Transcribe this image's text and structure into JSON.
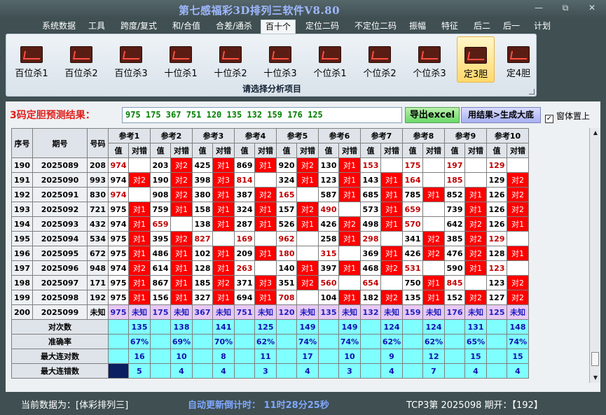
{
  "window": {
    "title": "第七感福彩3D排列三软件V8.80",
    "min": "—",
    "max": "⧉",
    "close": "✕"
  },
  "menu": [
    "系统数据",
    "工具",
    "跨度/复式",
    "和/合值",
    "合差/通杀",
    "百十个",
    "定位二码",
    "不定位二码",
    "振幅",
    "特征",
    "后二",
    "后一",
    "计划"
  ],
  "menu_active_index": 5,
  "ribbon": {
    "buttons": [
      "百位杀1",
      "百位杀2",
      "百位杀3",
      "十位杀1",
      "十位杀2",
      "十位杀3",
      "个位杀1",
      "个位杀2",
      "个位杀3",
      "定3胆",
      "定4胆"
    ],
    "selected_index": 9,
    "caption": "请选择分析项目"
  },
  "prediction": {
    "label": "3码定胆预测结果：",
    "value": "975 175 367 751 120 135 132 159 176 125",
    "export_button": "导出excel",
    "generate_button": "用结果>生成大底",
    "topmost_checkbox": "窗体置上",
    "topmost_checked": true
  },
  "table": {
    "col_seq": "序号",
    "col_issue": "期号",
    "col_code": "号码",
    "ref_headers": [
      "参考1",
      "参考2",
      "参考3",
      "参考4",
      "参考5",
      "参考6",
      "参考7",
      "参考8",
      "参考9",
      "参考10"
    ],
    "sub_value": "值",
    "sub_result": "对错",
    "rows": [
      {
        "seq": "190",
        "issue": "2025089",
        "code": "208",
        "vals": [
          "974",
          "203",
          "425",
          "869",
          "920",
          "130",
          "153",
          "175",
          "197",
          "129"
        ],
        "res": [
          "",
          "对2",
          "对1",
          "对1",
          "对2",
          "对1",
          "",
          "",
          "",
          ""
        ]
      },
      {
        "seq": "191",
        "issue": "2025090",
        "code": "993",
        "vals": [
          "974",
          "190",
          "398",
          "814",
          "324",
          "123",
          "143",
          "164",
          "185",
          "129"
        ],
        "res": [
          "对2",
          "对2",
          "对3",
          "",
          "对1",
          "对1",
          "对1",
          "",
          "",
          "对2"
        ]
      },
      {
        "seq": "192",
        "issue": "2025091",
        "code": "830",
        "vals": [
          "974",
          "908",
          "380",
          "387",
          "165",
          "587",
          "685",
          "785",
          "852",
          "126"
        ],
        "res": [
          "",
          "对2",
          "对1",
          "对2",
          "",
          "对1",
          "对1",
          "对1",
          "对1",
          "对2"
        ]
      },
      {
        "seq": "193",
        "issue": "2025092",
        "code": "721",
        "vals": [
          "975",
          "759",
          "158",
          "324",
          "157",
          "490",
          "573",
          "659",
          "739",
          "126"
        ],
        "res": [
          "对1",
          "对1",
          "对1",
          "对1",
          "对2",
          "",
          "对1",
          "",
          "对1",
          "对2"
        ]
      },
      {
        "seq": "194",
        "issue": "2025093",
        "code": "432",
        "vals": [
          "974",
          "659",
          "138",
          "287",
          "526",
          "426",
          "498",
          "570",
          "642",
          "126"
        ],
        "res": [
          "对1",
          "",
          "对1",
          "对1",
          "对1",
          "对2",
          "对1",
          "",
          "对2",
          "对1"
        ]
      },
      {
        "seq": "195",
        "issue": "2025094",
        "code": "534",
        "vals": [
          "975",
          "395",
          "827",
          "169",
          "962",
          "258",
          "298",
          "341",
          "385",
          "129"
        ],
        "res": [
          "对1",
          "对2",
          "",
          "",
          "",
          "对1",
          "",
          "对2",
          "对2",
          ""
        ]
      },
      {
        "seq": "196",
        "issue": "2025095",
        "code": "672",
        "vals": [
          "975",
          "486",
          "102",
          "209",
          "180",
          "315",
          "369",
          "426",
          "476",
          "128"
        ],
        "res": [
          "对1",
          "对1",
          "对1",
          "对1",
          "",
          "",
          "对1",
          "对2",
          "对2",
          "对1"
        ]
      },
      {
        "seq": "197",
        "issue": "2025096",
        "code": "948",
        "vals": [
          "974",
          "614",
          "128",
          "263",
          "140",
          "397",
          "468",
          "531",
          "590",
          "123"
        ],
        "res": [
          "对2",
          "对1",
          "对1",
          "",
          "对1",
          "对1",
          "对2",
          "",
          "对1",
          ""
        ]
      },
      {
        "seq": "198",
        "issue": "2025097",
        "code": "171",
        "vals": [
          "975",
          "867",
          "185",
          "371",
          "351",
          "560",
          "654",
          "750",
          "845",
          "123"
        ],
        "res": [
          "对1",
          "对1",
          "对2",
          "对3",
          "对2",
          "",
          "",
          "对1",
          "",
          "对2"
        ]
      },
      {
        "seq": "199",
        "issue": "2025098",
        "code": "192",
        "vals": [
          "975",
          "156",
          "327",
          "694",
          "708",
          "104",
          "182",
          "135",
          "152",
          "127"
        ],
        "res": [
          "对1",
          "对1",
          "对1",
          "对1",
          "",
          "对1",
          "对2",
          "对1",
          "对2",
          "对2"
        ]
      }
    ],
    "miss_values": [
      [
        "974",
        "974",
        "974"
      ],
      [],
      [],
      [],
      [],
      [],
      [],
      [],
      [],
      []
    ],
    "pred_row": {
      "seq": "200",
      "issue": "2025099",
      "code": "未知",
      "vals": [
        "975",
        "175",
        "367",
        "751",
        "120",
        "135",
        "132",
        "159",
        "176",
        "125"
      ],
      "res_text": "未知"
    },
    "stats": [
      {
        "label": "对次数",
        "vals": [
          "135",
          "138",
          "141",
          "125",
          "149",
          "149",
          "124",
          "124",
          "131",
          "148"
        ]
      },
      {
        "label": "准确率",
        "vals": [
          "67%",
          "69%",
          "70%",
          "62%",
          "74%",
          "74%",
          "62%",
          "62%",
          "65%",
          "74%"
        ]
      },
      {
        "label": "最大连对数",
        "vals": [
          "16",
          "10",
          "8",
          "11",
          "17",
          "10",
          "9",
          "12",
          "15",
          "15"
        ]
      },
      {
        "label": "最大连错数",
        "vals": [
          "5",
          "4",
          "4",
          "3",
          "4",
          "3",
          "4",
          "7",
          "4",
          "4"
        ]
      }
    ]
  },
  "status": {
    "current_data": "当前数据为：[体彩排列三]",
    "countdown": "自动更新倒计时： 11时28分25秒",
    "issue_info": "TCP3第 2025098 期开：【192】"
  }
}
